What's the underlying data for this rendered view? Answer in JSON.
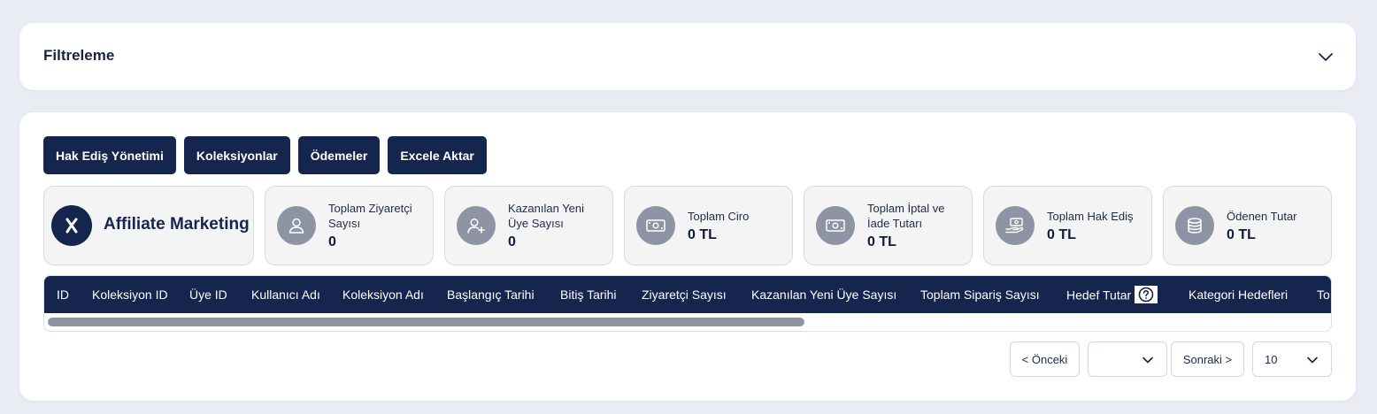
{
  "filter": {
    "title": "Filtreleme"
  },
  "toolbar": {
    "buttons": [
      "Hak Ediş Yönetimi",
      "Koleksiyonlar",
      "Ödemeler",
      "Excele Aktar"
    ]
  },
  "brand": {
    "logo_letter": "X",
    "name": "Affiliate Marketing"
  },
  "stats": [
    {
      "label": "Toplam Ziyaretçi Sayısı",
      "value": "0",
      "icon": "user-icon"
    },
    {
      "label": "Kazanılan Yeni Üye Sayısı",
      "value": "0",
      "icon": "user-plus-icon"
    },
    {
      "label": "Toplam Ciro",
      "value": "0 TL",
      "icon": "money-icon"
    },
    {
      "label": "Toplam İptal ve İade Tutarı",
      "value": "0 TL",
      "icon": "money-icon"
    },
    {
      "label": "Toplam Hak Ediş",
      "value": "0 TL",
      "icon": "hand-money-icon"
    },
    {
      "label": "Ödenen Tutar",
      "value": "0 TL",
      "icon": "coins-stack-icon"
    }
  ],
  "table": {
    "columns": [
      "ID",
      "Koleksiyon ID",
      "Üye ID",
      "Kullanıcı Adı",
      "Koleksiyon Adı",
      "Başlangıç Tarihi",
      "Bitiş Tarihi",
      "Ziyaretçi Sayısı",
      "Kazanılan Yeni Üye Sayısı",
      "Toplam Sipariş Sayısı",
      "Hedef Tutar",
      "Kategori Hedefleri",
      "To"
    ]
  },
  "pagination": {
    "prev_label": "< Önceki",
    "page_value": "",
    "next_label": "Sonraki >",
    "page_size": "10"
  }
}
